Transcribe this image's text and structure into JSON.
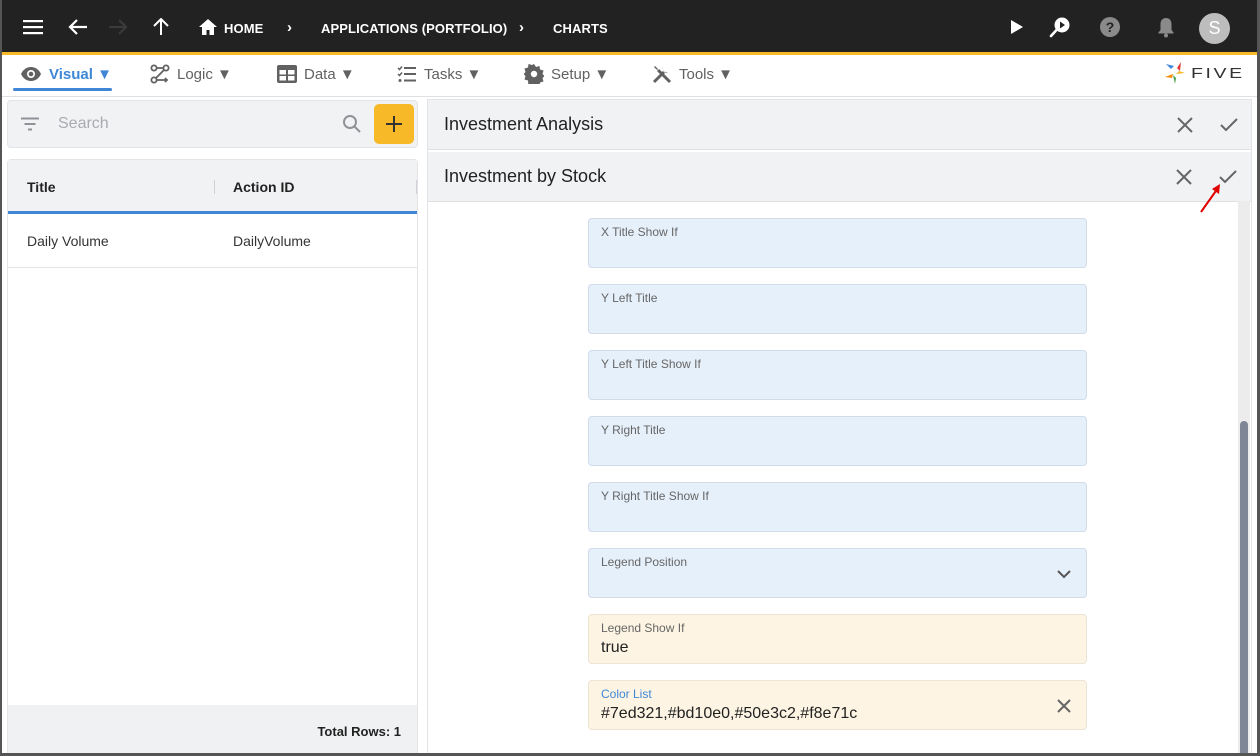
{
  "topbar": {
    "breadcrumbs": [
      "HOME",
      "APPLICATIONS (PORTFOLIO)",
      "CHARTS"
    ],
    "icons": [
      "menu-icon",
      "back-arrow-icon",
      "forward-arrow-icon",
      "up-arrow-icon",
      "home-icon",
      "play-icon",
      "search-run-icon",
      "help-icon",
      "notifications-icon"
    ],
    "avatar_initial": "S",
    "accent_color": "#f7b928"
  },
  "menubar": {
    "items": [
      {
        "label": "Visual ▼",
        "icon": "eye-icon",
        "active": true
      },
      {
        "label": "Logic ▼",
        "icon": "logic-flow-icon"
      },
      {
        "label": "Data ▼",
        "icon": "table-icon"
      },
      {
        "label": "Tasks ▼",
        "icon": "checklist-icon"
      },
      {
        "label": "Setup ▼",
        "icon": "gear-icon"
      },
      {
        "label": "Tools ▼",
        "icon": "tools-icon"
      }
    ],
    "logo_text": "FIVE",
    "active_color": "#3f87d6"
  },
  "left_panel": {
    "search": {
      "placeholder": "Search",
      "value": ""
    },
    "grid": {
      "columns": [
        "Title",
        "Action ID"
      ],
      "rows": [
        {
          "title": "Daily Volume",
          "action_id": "DailyVolume"
        }
      ],
      "footer": "Total Rows: 1"
    }
  },
  "right_panel": {
    "parent_header": "Investment Analysis",
    "child_header": "Investment by Stock",
    "fields": [
      {
        "label": "X Title Show If",
        "value": ""
      },
      {
        "label": "Y Left Title",
        "value": ""
      },
      {
        "label": "Y Left Title Show If",
        "value": ""
      },
      {
        "label": "Y Right Title",
        "value": ""
      },
      {
        "label": "Y Right Title Show If",
        "value": ""
      },
      {
        "label": "Legend Position",
        "value": ""
      },
      {
        "label": "Legend Show If",
        "value": "true"
      },
      {
        "label": "Color List",
        "value": "#7ed321,#bd10e0,#50e3c2,#f8e71c"
      }
    ]
  }
}
